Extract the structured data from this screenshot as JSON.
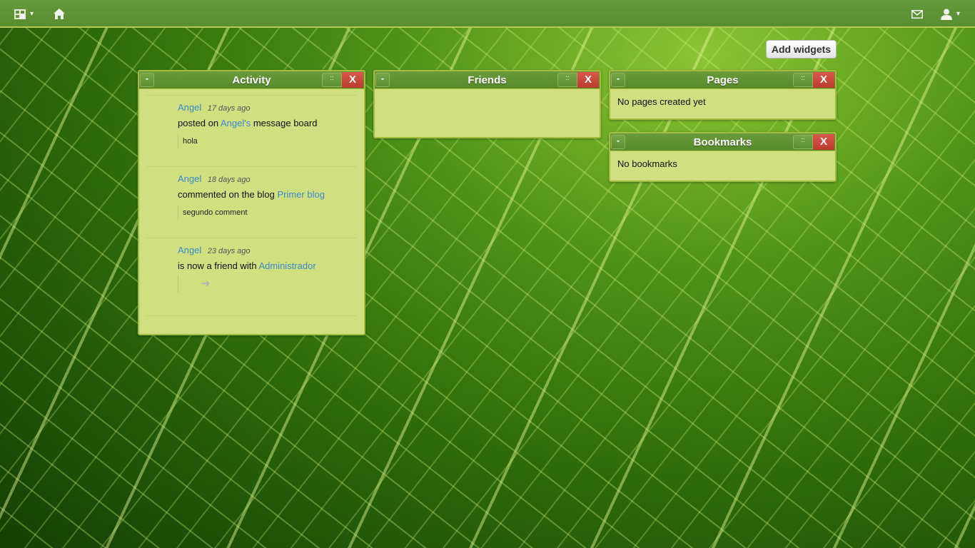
{
  "topbar": {
    "dashboard_icon": "dashboard-grid-icon",
    "dashboard_caret": "▾",
    "home_icon": "home-icon",
    "messages_icon": "envelope-icon",
    "user_icon": "user-silhouette-icon",
    "user_caret": "▾"
  },
  "add_widgets_label": "Add widgets",
  "widget_controls": {
    "minimize": "-",
    "drag": "::",
    "close": "X"
  },
  "widgets": {
    "activity": {
      "title": "Activity",
      "items": [
        {
          "user": "Angel",
          "time": "17 days ago",
          "action_pre": "posted on ",
          "action_link": "Angel's",
          "action_post": " message board",
          "excerpt": "hola"
        },
        {
          "user": "Angel",
          "time": "18 days ago",
          "action_pre": "commented on the blog ",
          "action_link": "Primer blog",
          "action_post": "",
          "excerpt": "segundo comment"
        },
        {
          "user": "Angel",
          "time": "23 days ago",
          "action_pre": "is now a friend with ",
          "action_link": "Administrador",
          "action_post": "",
          "excerpt_icon": "arrow-right-icon"
        }
      ]
    },
    "friends": {
      "title": "Friends"
    },
    "pages": {
      "title": "Pages",
      "body": "No pages created yet"
    },
    "bookmarks": {
      "title": "Bookmarks",
      "body": "No bookmarks"
    }
  },
  "colors": {
    "topbar": "#5f9334",
    "widget_body": "#d0df80",
    "widget_header": "#609338",
    "close_button": "#c94438",
    "link": "#3e88c8"
  }
}
